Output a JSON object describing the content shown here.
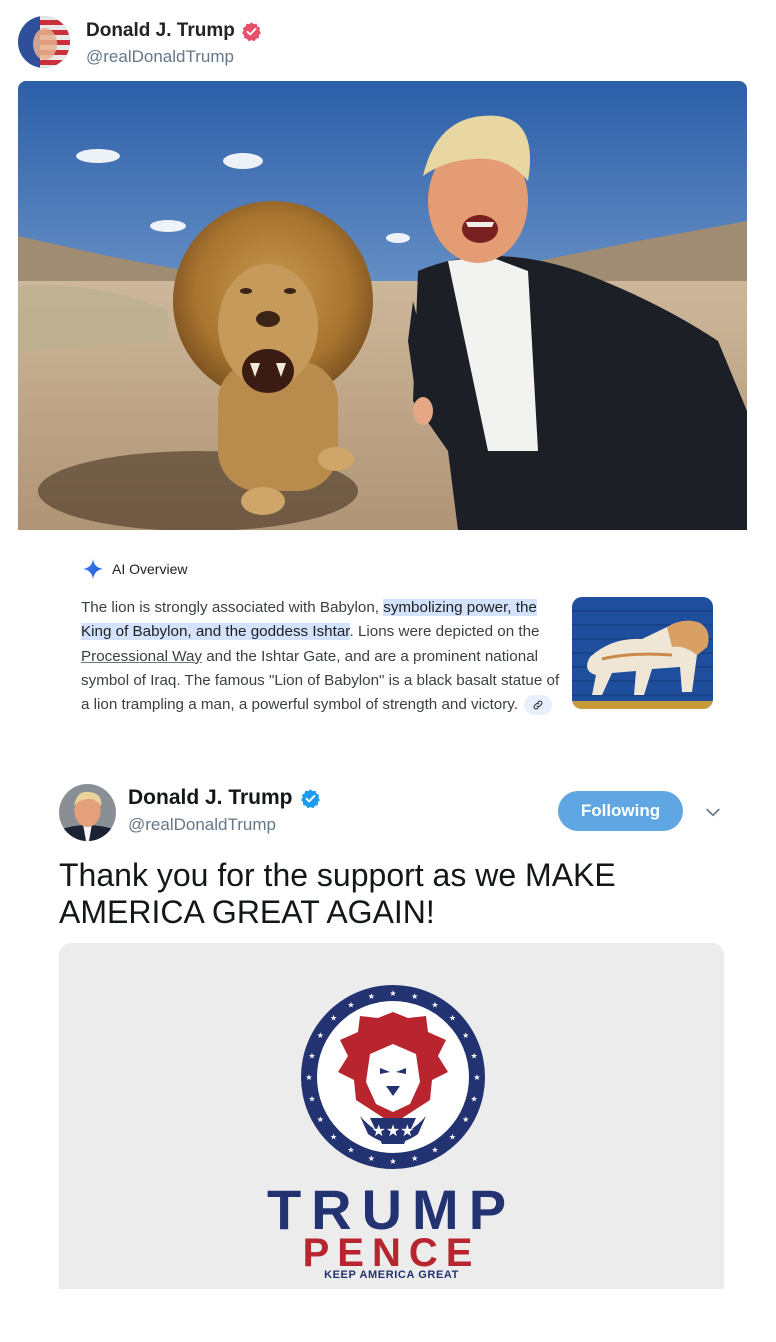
{
  "post1": {
    "author_name": "Donald J. Trump",
    "author_handle": "@realDonaldTrump",
    "verified_badge_color": "#e5506b"
  },
  "ai_overview": {
    "title": "AI Overview",
    "text": {
      "part1": "The lion is strongly associated with Babylon, ",
      "highlight": "symbolizing power, the King of Babylon, and the goddess Ishtar",
      "part2": ". Lions were depic­ted on the ",
      "link": "Processional Way",
      "part3": " and the Ishtar Gate, and are a prom­inent national symbol of Iraq. The famous \"Lion of Babylon\" is a black basalt statue of a lion trampling a man, a powerful symbol of strength and victory."
    },
    "link_icon": "link-icon"
  },
  "post2": {
    "author_name": "Donald J. Trump",
    "author_handle": "@realDonaldTrump",
    "follow_label": "Following",
    "tweet_text": "Thank you for the support as we MAKE AMERICA GREAT AGAIN!",
    "verified_badge_color": "#1d9bf0",
    "logo": {
      "line1": "TRUMP",
      "line2": "PENCE",
      "tagline": "KEEP AMERICA GREAT"
    }
  },
  "colors": {
    "follow_button": "#5fa6e3",
    "logo_navy": "#233270",
    "logo_red": "#b9252f",
    "ai_highlight": "#d3e3fd"
  }
}
